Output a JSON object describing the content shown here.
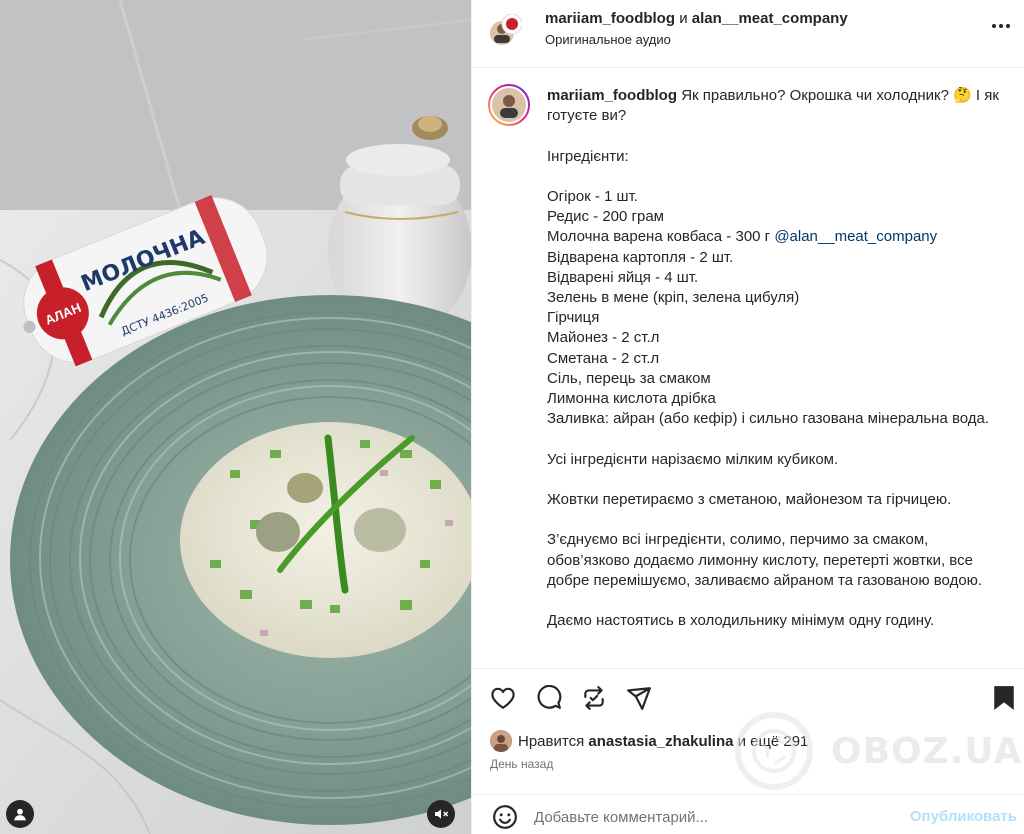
{
  "post": {
    "author": "mariiam_foodblog",
    "conjunction": "и",
    "coauthor": "alan__meat_company",
    "audio": "Оригинальное аудио"
  },
  "media": {
    "package_brand": "АЛАН",
    "package_name": "МОЛОЧНА",
    "package_standard": "ДСТУ 4436:2005"
  },
  "caption": {
    "author": "mariiam_foodblog",
    "intro": "Як правильно? Окрошка чи холодник? 🤔 І як готуєте ви?",
    "ingredients_title": "Інгредієнти:",
    "ingredients": [
      "Огірок - 1 шт.",
      "Редис - 200 грам",
      "Молочна варена ковбаса - 300 г",
      "Відварена картопля - 2 шт.",
      "Відварені яйця - 4 шт.",
      "Зелень в мене (кріп, зелена цибуля)",
      "Гірчиця",
      "Майонез - 2 ст.л",
      "Сметана - 2 ст.л",
      "Сіль, перець за смаком",
      "Лимонна кислота дрібка",
      "Заливка: айран (або кефір) і сильно газована мінеральна вода."
    ],
    "mention": "@alan__meat_company",
    "step1": "Усі інгредієнти нарізаємо мілким кубиком.",
    "step2": "Жовтки перетираємо з сметаною, майонезом та гірчицею.",
    "step3": "З’єднуємо всі інгредієнти, солимо, перчимо за смаком, обов’язково додаємо лимонну кислоту, перетерті жовтки, все добре перемішуємо, заливаємо айраном та газованою водою.",
    "step4": "Даємо настоятись в холодильнику мінімум одну годину."
  },
  "likes": {
    "prefix": "Нравится",
    "user": "anastasia_zhakulina",
    "suffix": "и ещё 291"
  },
  "time_ago": "День назад",
  "comment": {
    "placeholder": "Добавьте комментарий...",
    "publish": "Опубликовать"
  },
  "watermark": "OBOZ.UA",
  "icons": [
    "more-icon",
    "heart-icon",
    "comment-icon",
    "repost-icon",
    "share-icon",
    "bookmark-icon",
    "emoji-icon",
    "user-icon",
    "mute-icon"
  ],
  "colors": {
    "link": "#00376b",
    "publish_disabled": "#b2dffc",
    "muted": "#737373",
    "plate": "#8fa9a0"
  }
}
